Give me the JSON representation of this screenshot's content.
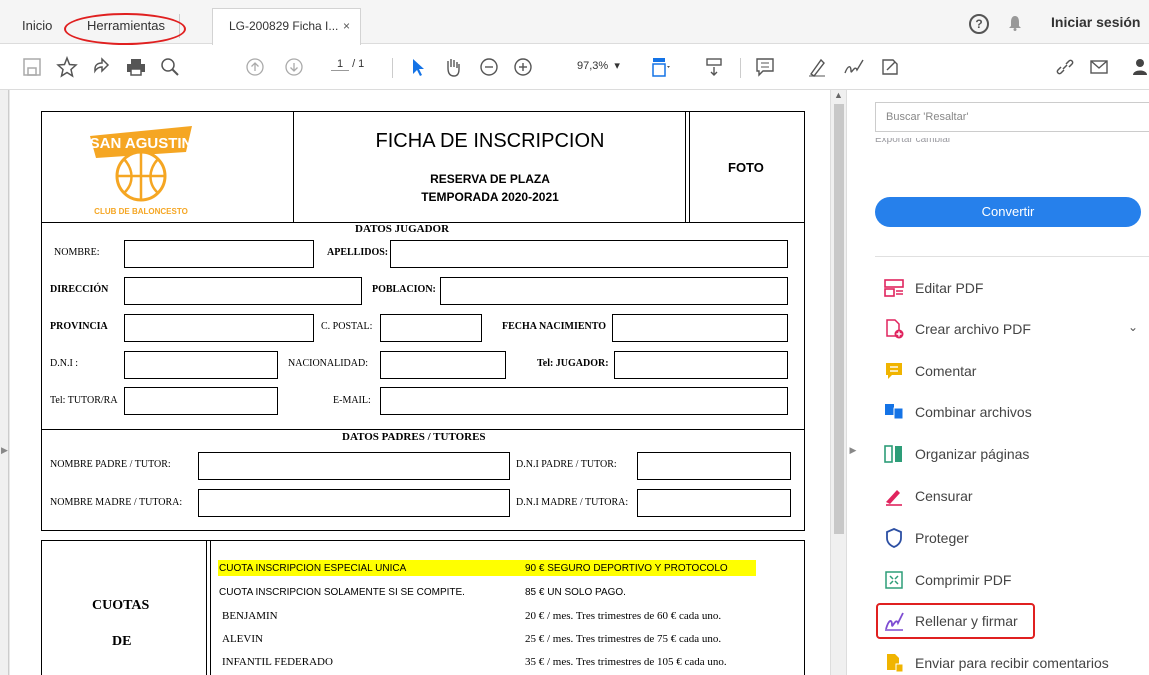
{
  "tabs": [
    {
      "label": "Inicio"
    },
    {
      "label": "Herramientas"
    },
    {
      "label": "LG-200829 Ficha I...",
      "close": "×"
    }
  ],
  "header": {
    "help": "?",
    "signin": "Iniciar sesión"
  },
  "toolbar": {
    "page_current": "1",
    "page_total": "/ 1",
    "zoom": "97,3%"
  },
  "document": {
    "logo_top": "SAN AGUSTIN",
    "logo_bottom": "CLUB DE BALONCESTO",
    "title": "FICHA DE INSCRIPCION",
    "subtitle1": "RESERVA DE PLAZA",
    "subtitle2": "TEMPORADA 2020-2021",
    "foto": "FOTO",
    "section_player": "DATOS JUGADOR",
    "nombre": "NOMBRE:",
    "apellidos": "APELLIDOS:",
    "direccion": "DIRECCIÓN",
    "poblacion": "POBLACION:",
    "provincia": "PROVINCIA",
    "cpostal": "C. POSTAL:",
    "fecha_nac": "FECHA NACIMIENTO",
    "dni": "D.N.I :",
    "nacionalidad": "NACIONALIDAD:",
    "tel_jugador": "Tel: JUGADOR:",
    "tel_tutor": "Tel: TUTOR/RA",
    "email": "E-MAIL:",
    "section_parents": "DATOS PADRES / TUTORES",
    "nombre_padre": "NOMBRE PADRE / TUTOR:",
    "dni_padre": "D.N.I PADRE / TUTOR:",
    "nombre_madre": "NOMBRE MADRE / TUTORA:",
    "dni_madre": "D.N.I MADRE / TUTORA:",
    "cuotas": "CUOTAS",
    "de": "DE",
    "fees": [
      {
        "name": "CUOTA INSCRIPCION  ESPECIAL UNICA",
        "value": "90 €  SEGURO DEPORTIVO Y PROTOCOLO",
        "highlight": true
      },
      {
        "name": "CUOTA INSCRIPCION SOLAMENTE SI SE COMPITE.",
        "value": "85 €   UN SOLO PAGO.",
        "highlight": false
      },
      {
        "name": "BENJAMIN",
        "value": "20 € / mes. Tres trimestres de 60 € cada uno.",
        "highlight": false
      },
      {
        "name": "ALEVIN",
        "value": "25 € / mes. Tres trimestres de 75 € cada uno.",
        "highlight": false
      },
      {
        "name": "INFANTIL FEDERADO",
        "value": "35 € / mes. Tres trimestres de 105 € cada uno.",
        "highlight": false
      }
    ]
  },
  "panel": {
    "search_placeholder": "Buscar 'Resaltar'",
    "cut_text": "Exportar  cambiar",
    "convert": "Convertir",
    "tools": [
      {
        "label": "Editar PDF",
        "icon": "edit-pdf-icon"
      },
      {
        "label": "Crear archivo PDF",
        "icon": "create-pdf-icon"
      },
      {
        "label": "Comentar",
        "icon": "comment-icon"
      },
      {
        "label": "Combinar archivos",
        "icon": "combine-icon"
      },
      {
        "label": "Organizar páginas",
        "icon": "organize-icon"
      },
      {
        "label": "Censurar",
        "icon": "redact-icon"
      },
      {
        "label": "Proteger",
        "icon": "protect-icon"
      },
      {
        "label": "Comprimir PDF",
        "icon": "compress-icon"
      },
      {
        "label": "Rellenar y firmar",
        "icon": "fill-sign-icon"
      },
      {
        "label": "Enviar para recibir comentarios",
        "icon": "send-review-icon"
      }
    ]
  },
  "colors": {
    "accent": "#2680eb",
    "highlight": "#ffff00",
    "annotation": "#e02020"
  }
}
